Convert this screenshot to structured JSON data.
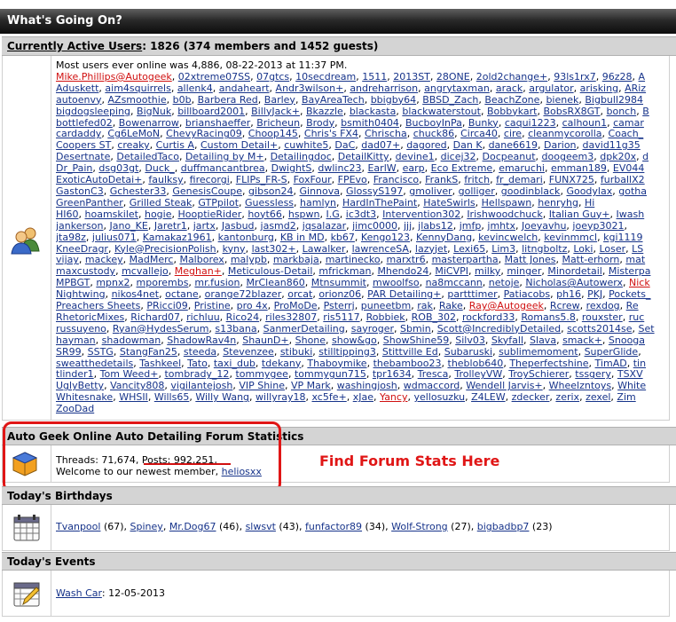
{
  "title": "What's Going On?",
  "active": {
    "heading_link": "Currently Active Users",
    "heading_text": ": 1826 (374 members and 1452 guests)",
    "most_users": "Most users ever online was 4,886, 08-22-2013 at 11:37 PM.",
    "lines": [
      "Mike.Phillips@Autogeek, 02xtreme07SS, 07gtcs, 10secdream, 1511, 2013ST, 28ONE, 2old2change+, 93ls1rx7, 96z28, A",
      "Aduskett, aim4squirrels, allenk4, andaheart, Andr3wilson+, andreharrison, angrytaxman, arack, argulator, arisking, ARiz",
      "autoenvy, AZsmoothie, b0b, Barbera Red, Barley, BayAreaTech, bbigby64, BBSD_Zach, BeachZone, bienek, Bigbull2984",
      "bigdogsleeping, BigNuk, billboard2001, BillyJack+, Bkazzle, blackasta, blackwaterstout, Bobbykart, BobsRX8GT, bonch, B",
      "bottlefed02, Bowenarrow, brianshaeffer, Bricheun, Brody, bsmith0404, BucboyInPa, Bunky, caqui1223, calhoun1, camar",
      "cardaddy, Cg6LeMoN, ChevyRacing09, Choop145, Chris's FX4, Chrischa, chuck86, Circa40, cire, cleanmycorolla, Coach_",
      "Coopers ST, creaky, Curtis A, Custom Detail+, cuwhite5, DaC, dad07+, dagored, Dan K, dane6619, Darion, david11g35",
      "Desertnate, DetailedTaco, Detailing by M+, Detailingdoc, DetailKitty, devine1, dicej32, Docpeanut, doogeem3, dpk20x, d",
      "Dr_Pain, dsg03gt, Duck_, duffmancantbrea, DwightS, dwlinc23, EarlW, earp, Eco Extreme, emaruchi, emman189, EV044",
      "ExoticAutoDetai+, faulksy, firecorgi, FLIPs_FR-S, FoxFour, FPEvo, Francisco, FrankS, fritch, fr_demari, FUNX725, furballX2",
      "GastonC3, Gchester33, GenesisCoupe, gibson24, Ginnova, GlossyS197, gmoliver, golliger, goodinblack, Goodylax, gotha",
      "GreenPanther, Grilled Steak, GTPpilot, Guessless, hamlyn, HardInThePaint, HateSwirls, Hellspawn, henryhg, Hi",
      "HI60, hoamskilet, hogie, HooptieRider, hoyt66, hspwn, I.G, ic3dt3, Intervention302, Irishwoodchuck, Italian Guy+, Iwash",
      "jankerson, Jano_KE, Jaretr1, jartx, Jasbud, jasmd2, jqsalazar, jimc0000, jjj, jlabs12, jmfp, jmhtx, Joeyavhu, joeyp3021,",
      "jta98z, julius071, Kamakaz1961, kantonburg, KB in MD, kb67, Kengo123, KennyDang, kevincwelch, kevinmmcl, kgi1119",
      "KneeDragr, Kyle@PrecisionPolish, kyny, last302+, Lawalker, lawrenceSA, lazyjet, Lexi65, Lim3, litngboltz, Loki, Loser, LS",
      "vijay, mackey, MadMerc, Malborex, malypb, markbaja, martinecko, marxtr6, masterpartha, Matt Jones, Matt-erhorn, mat",
      "maxcustody, mcvallejo, Meghan+, Meticulous-Detail, mfrickman, Mhendo24, MiCVPI, milky, minger, Minordetail, Misterpa",
      "MPBGT, mpnx2, mporembs, mr.fusion, MrClean860, Mtnsummit, mwoolfso, na8mccann, netoje, Nicholas@Autowerx, Nick",
      "Nightwing, nikos4net, octane, orange72blazer, orcat, orionz06, PAR Detailing+, partttimer, Patiacobs, ph16, PKJ, Pockets_",
      "Preachers Sheets, PRicci09, Pristine, pro 4x, ProMoDe, Psterrj, puneetbm, rak, Rake, Ray@Autogeek, Rcrew, rexdog, Re",
      "RhetoricMixes, Richard07, richluu, Rico24, riles32807, ris5117, Robbiek, ROB_302, rockford33, Romans5.8, rouxster, ruc",
      "russuyeno, Ryan@HydesSerum, s13bana, SanmerDetailing, sayroger, Sbmin, Scott@IncrediblyDetailed, scotts2014se, Set",
      "hayman, shadowman, ShadowRav4n, ShaunD+, Shone, show&go, ShowShine59, Silv03, Skyfall, Slava, smack+, Snooga",
      "SR99, SSTG, StangFan25, steeda, Stevenzee, stibuki, stilltipping3, Stittville Ed, Subaruski, sublimemoment, SuperGlide,",
      "sweatthedetails, Tashkeel, Tato, taxi_dub, tdekany, Thaboymike, thebamboo23, theblob640, Theperfectshine, TimAD, tin",
      "tlinder1, Tom Weed+, tombrady_12, tommygee, tommygun715, tpr1634, Tresca, TrolleyVW, TroySchierer, tssgery, TSXV",
      "UglyBetty, Vancity808, vigilantejosh, VIP Shine, VP Mark, washingjosh, wdmaccord, Wendell Jarvis+, Wheelzntoys, White",
      "Whitesnake, WHSII, Wills65, Willy Wang, willyray18, xc5fe+, xJae, Yancy, yellosuzku, Z4LEW, zdecker, zerix, zexel, Zim",
      "ZooDad"
    ]
  },
  "stats": {
    "heading": "Auto Geek Online Auto Detailing Forum Statistics",
    "threads_label": "Threads: 71,674, ",
    "posts_label": "Posts: 992,251",
    "posts_after": ",",
    "welcome": "Welcome to our newest member, ",
    "newest_member": "heliosxx"
  },
  "annotation": "Find Forum Stats Here",
  "birthdays": {
    "heading": "Today's Birthdays",
    "items": [
      {
        "name": "Tvanpool",
        "age": " (67), "
      },
      {
        "name": "Spiney",
        "age": ", "
      },
      {
        "name": "Mr.Dog67",
        "age": " (46), "
      },
      {
        "name": "slwsvt",
        "age": " (43), "
      },
      {
        "name": "funfactor89",
        "age": " (34), "
      },
      {
        "name": "Wolf-Strong",
        "age": " (27), "
      },
      {
        "name": "bigbadbp7",
        "age": " (23)"
      }
    ]
  },
  "events": {
    "heading": "Today's Events",
    "event_link": "Wash Car",
    "event_date": ": 12-05-2013"
  },
  "icons": {
    "users": "users-icon",
    "stats": "stats-cube-icon",
    "birthdays": "calendar-icon",
    "events": "calendar-pencil-icon"
  },
  "colors": {
    "link": "#16338a",
    "highlight": "#e01616",
    "section_bg": "#d4d4d4"
  }
}
